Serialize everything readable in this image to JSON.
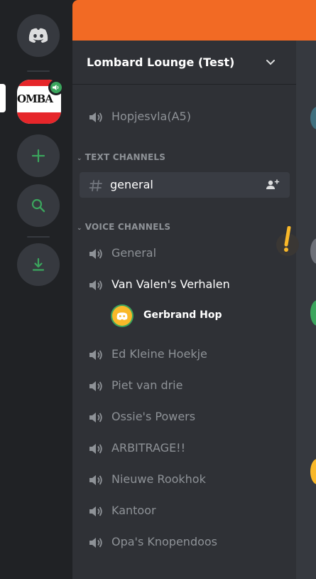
{
  "server": {
    "name": "Lombard Lounge (Test)",
    "logo_text": "OMBA"
  },
  "channels": {
    "top": [
      {
        "name": "Hopjesvla(A5)",
        "type": "voice"
      }
    ],
    "categories": [
      {
        "label": "TEXT CHANNELS",
        "channels": [
          {
            "name": "general",
            "type": "text",
            "active": true
          }
        ]
      },
      {
        "label": "VOICE CHANNELS",
        "channels": [
          {
            "name": "General",
            "type": "voice"
          },
          {
            "name": "Van Valen's Verhalen",
            "type": "voice",
            "connected": true
          },
          {
            "name": "Ed Kleine Hoekje",
            "type": "voice"
          },
          {
            "name": "Piet van drie",
            "type": "voice"
          },
          {
            "name": "Ossie's Powers",
            "type": "voice"
          },
          {
            "name": "ARBITRAGE!!",
            "type": "voice"
          },
          {
            "name": "Nieuwe Rookhok",
            "type": "voice"
          },
          {
            "name": "Kantoor",
            "type": "voice"
          },
          {
            "name": "Opa's Knopendoos",
            "type": "voice"
          }
        ]
      }
    ]
  },
  "voice_users": [
    {
      "name": "Gerbrand Hop",
      "channel": "Van Valen's Verhalen"
    }
  ],
  "colors": {
    "rail_bg": "#202225",
    "sidebar_bg": "#2f3136",
    "active_channel_bg": "#393c43",
    "muted_text": "#8e9297",
    "green_accent": "#3ba55d",
    "orange_banner": "#f26a24"
  },
  "icons": {
    "home": "discord-logo-icon",
    "add_server": "plus-icon",
    "explore": "search-icon",
    "download": "download-icon",
    "voice": "speaker-icon",
    "text": "hash-icon",
    "invite": "add-member-icon",
    "header": "chevron-down-icon"
  }
}
